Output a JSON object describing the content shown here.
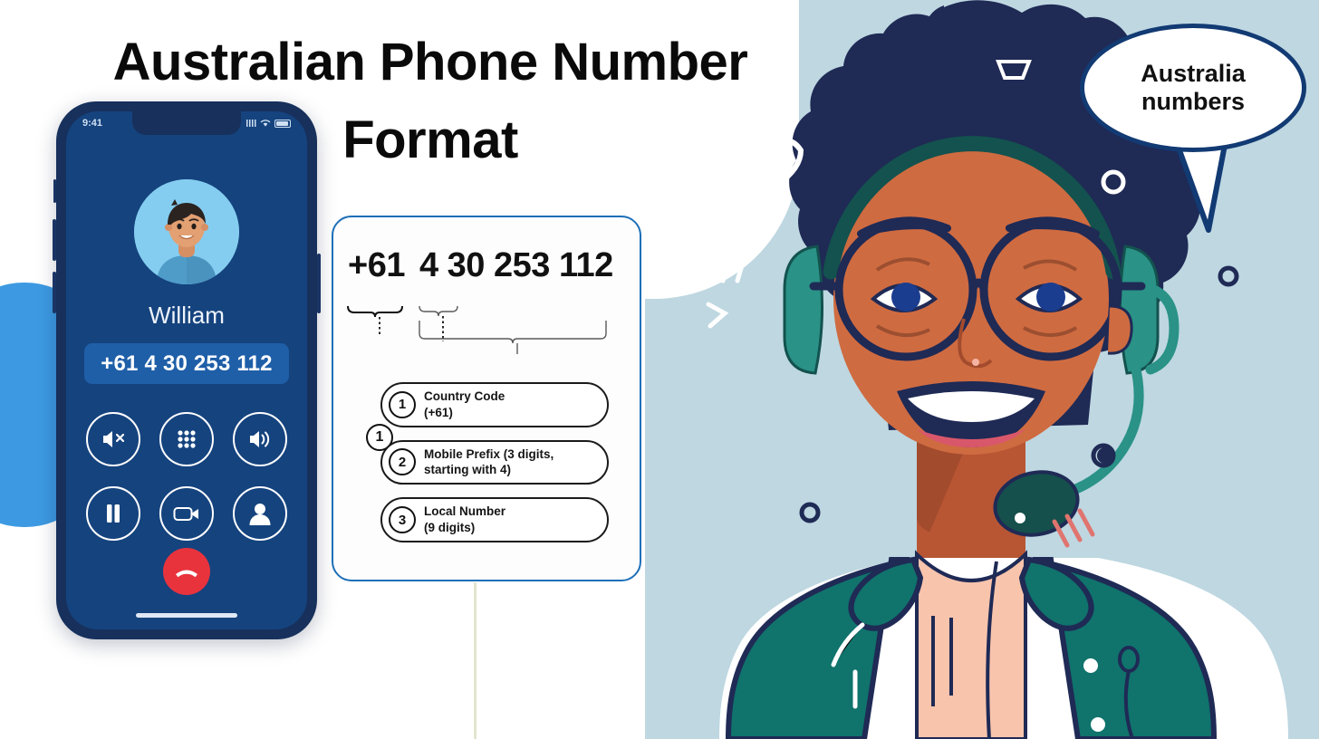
{
  "title": {
    "line1": "Australian Phone Number",
    "line2": "Format"
  },
  "phone": {
    "status": {
      "time": "9:41",
      "signal_icon": "signal-bars-icon",
      "wifi_icon": "wifi-icon",
      "battery_icon": "battery-icon"
    },
    "avatar_icon": "contact-avatar",
    "contact_name": "William",
    "phone_number": "+61 4 30 253 112",
    "call_controls": [
      {
        "name": "mute-button",
        "icon": "speaker-mute-icon"
      },
      {
        "name": "keypad-button",
        "icon": "dialpad-icon"
      },
      {
        "name": "speaker-button",
        "icon": "speaker-loud-icon"
      },
      {
        "name": "hold-button",
        "icon": "pause-icon"
      },
      {
        "name": "video-button",
        "icon": "video-camera-icon"
      },
      {
        "name": "add-contact-button",
        "icon": "person-icon"
      }
    ],
    "end_call": {
      "name": "end-call-button",
      "icon": "phone-hangup-icon",
      "color": "#e8333d"
    }
  },
  "breakdown": {
    "number_country_code": "+61",
    "number_rest": "4 30 253 112",
    "markers": [
      "1",
      "2",
      "3"
    ],
    "legend": [
      {
        "num": "1",
        "line1": "Country Code",
        "line2": "(+61)"
      },
      {
        "num": "2",
        "line1": "Mobile Prefix (3 digits,",
        "line2": "starting with 4)"
      },
      {
        "num": "3",
        "line1": "Local Number",
        "line2": "(9 digits)"
      }
    ]
  },
  "speech_bubble": {
    "line1": "Australia",
    "line2": "numbers"
  },
  "illustration": {
    "alt": "smiling-woman-with-headset",
    "decorations": [
      "heart-outline-icon",
      "double-slash-icon",
      "arrow-glyph-icon",
      "ring-dot-icon",
      "trapezoid-icon"
    ]
  },
  "colors": {
    "bg_right": "#bed7e1",
    "card_border": "#1d6fb8",
    "phone_body": "#17305c",
    "phone_screen": "#15437e",
    "number_pill": "#1f5fa8",
    "accent_blue": "#3d9ae2",
    "navy": "#1c2a52",
    "teal": "#1c7a74",
    "skin": "#cf6b41",
    "shirt": "#f9c4ac",
    "end_call_red": "#e8333d",
    "connector": "#e3e5d0"
  }
}
